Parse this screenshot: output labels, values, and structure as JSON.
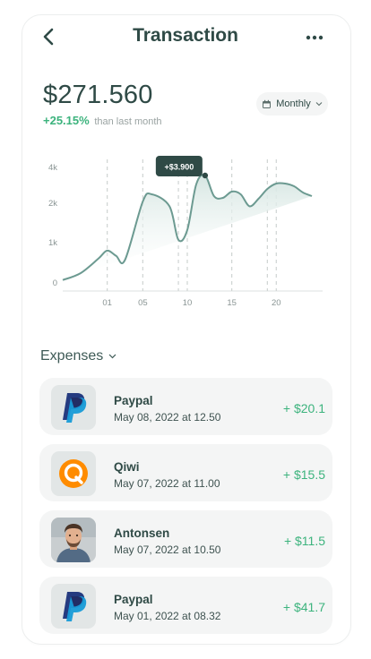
{
  "header": {
    "title": "Transaction",
    "back_icon": "chevron-left-icon",
    "more_icon": "more-horizontal-icon"
  },
  "summary": {
    "amount": "$271.560",
    "change_pct": "+25.15%",
    "change_text": "than last month"
  },
  "period_select": {
    "label": "Monthly",
    "icon": "calendar-icon"
  },
  "chart_data": {
    "type": "area",
    "title": "",
    "xlabel": "",
    "ylabel": "",
    "x_ticks": [
      "01",
      "05",
      "10",
      "15",
      "20"
    ],
    "y_ticks": [
      "0",
      "1k",
      "2k",
      "4k"
    ],
    "tooltip": "+$3.900",
    "series": [
      {
        "x": [
          -4,
          -2,
          0,
          1,
          2,
          3,
          5,
          6,
          8,
          9,
          10,
          11,
          12,
          13,
          14,
          15,
          16,
          17,
          18,
          19,
          20,
          21,
          22,
          23,
          24
        ],
        "y": [
          0.05,
          0.22,
          0.58,
          0.78,
          0.65,
          0.55,
          2.05,
          2.45,
          1.9,
          1.05,
          1.3,
          3.0,
          3.5,
          2.35,
          2.25,
          2.6,
          2.45,
          1.9,
          2.2,
          2.75,
          3.05,
          3.05,
          2.9,
          2.55,
          2.35
        ]
      }
    ],
    "colors": {
      "line": "#6c9a91",
      "fill": "#d6e6e2",
      "tooltip_bg": "#2f4a46"
    }
  },
  "expenses": {
    "title": "Expenses",
    "items": [
      {
        "name": "Paypal",
        "date": "May 08, 2022 at 12.50",
        "amount": "+ $20.1",
        "logo": "paypal-logo"
      },
      {
        "name": "Qiwi",
        "date": "May 07, 2022 at 11.00",
        "amount": "+ $15.5",
        "logo": "qiwi-logo"
      },
      {
        "name": "Antonsen",
        "date": "May 07, 2022 at 10.50",
        "amount": "+ $11.5",
        "logo": "person-avatar"
      },
      {
        "name": "Paypal",
        "date": "May 01, 2022 at 08.32",
        "amount": "+ $41.7",
        "logo": "paypal-logo"
      }
    ]
  }
}
